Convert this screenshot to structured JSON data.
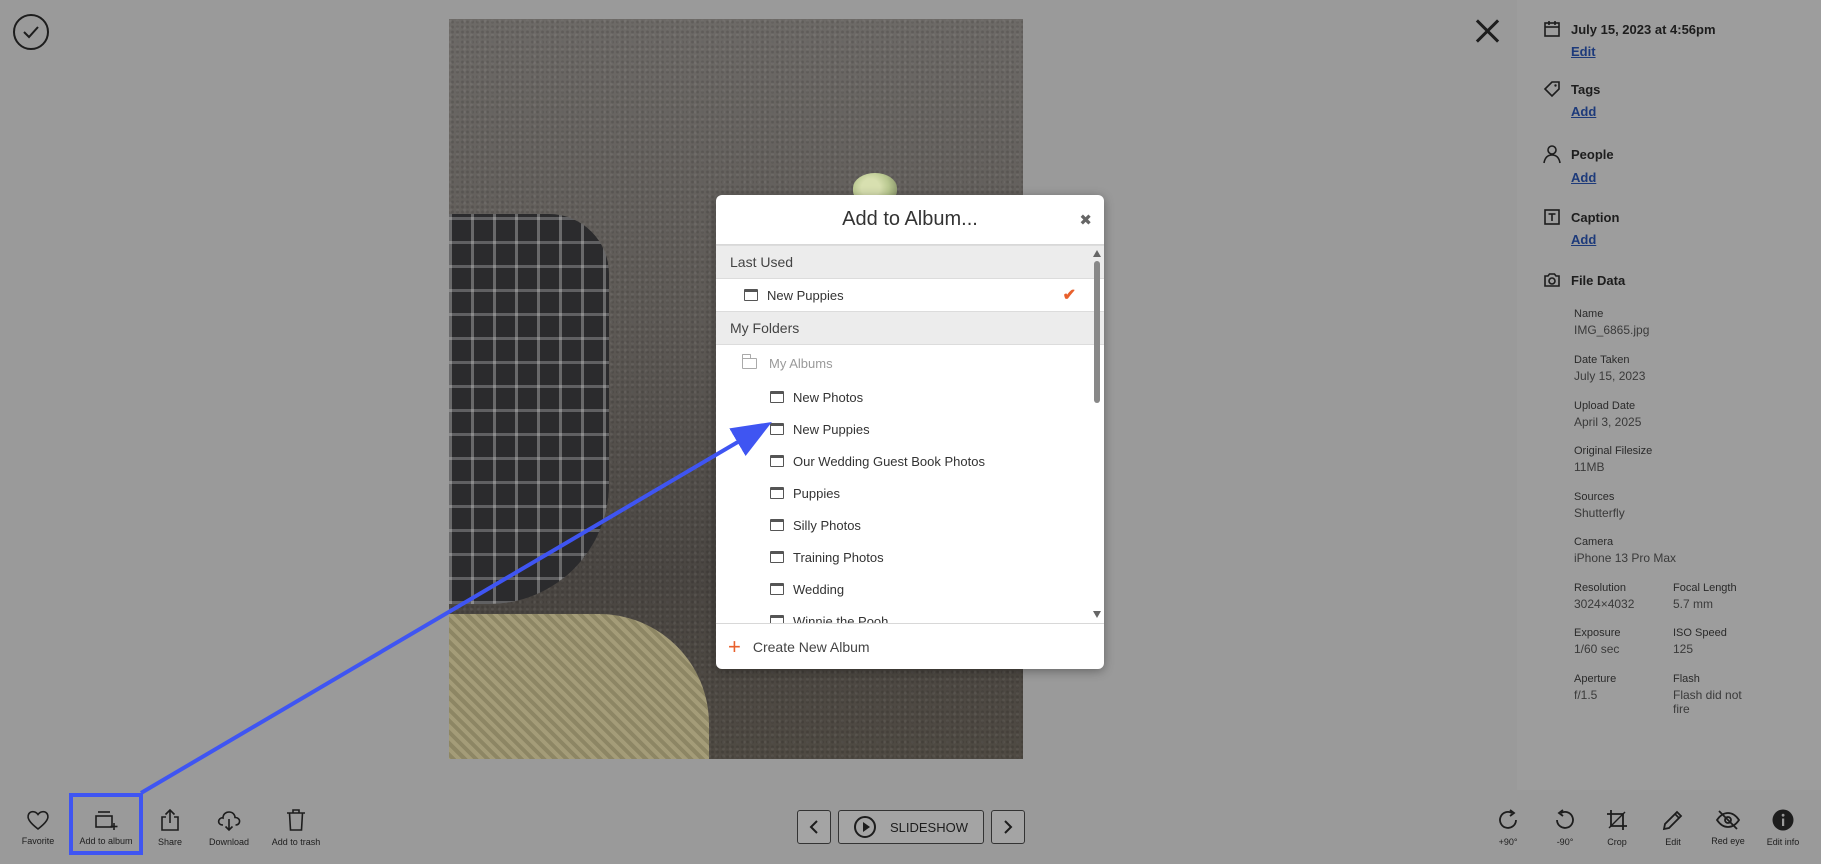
{
  "modal": {
    "title": "Add to Album...",
    "close": "✖",
    "last_used_header": "Last Used",
    "last_used_item": "New Puppies",
    "my_folders_header": "My Folders",
    "folder_name": "My Albums",
    "albums": [
      "New Photos",
      "New Puppies",
      "Our Wedding Guest Book Photos",
      "Puppies",
      "Silly Photos",
      "Training Photos",
      "Wedding",
      "Winnie the Pooh"
    ],
    "create_label": "Create New Album",
    "check": "✔",
    "plus": "+"
  },
  "toolbar": {
    "favorite": "Favorite",
    "add_to_album": "Add to album",
    "share": "Share",
    "download": "Download",
    "add_to_trash": "Add to trash",
    "slideshow": "SLIDESHOW",
    "rotate_cw": "+90°",
    "rotate_ccw": "-90°",
    "crop": "Crop",
    "edit": "Edit",
    "red_eye": "Red eye",
    "edit_info": "Edit info"
  },
  "info": {
    "date": "July 15, 2023 at 4:56pm",
    "date_edit": "Edit",
    "tags_title": "Tags",
    "tags_add": "Add",
    "people_title": "People",
    "people_add": "Add",
    "caption_title": "Caption",
    "caption_add": "Add",
    "file_data_title": "File Data",
    "file_data": {
      "name_label": "Name",
      "name": "IMG_6865.jpg",
      "date_taken_label": "Date Taken",
      "date_taken": "July 15, 2023",
      "upload_date_label": "Upload Date",
      "upload_date": "April 3, 2025",
      "filesize_label": "Original Filesize",
      "filesize": "11MB",
      "sources_label": "Sources",
      "sources": "Shutterfly",
      "camera_label": "Camera",
      "camera": "iPhone 13 Pro Max",
      "resolution_label": "Resolution",
      "resolution": "3024×4032",
      "focal_label": "Focal Length",
      "focal": "5.7 mm",
      "exposure_label": "Exposure",
      "exposure": "1/60 sec",
      "iso_label": "ISO Speed",
      "iso": "125",
      "aperture_label": "Aperture",
      "aperture": "f/1.5",
      "flash_label": "Flash",
      "flash": "Flash did not fire"
    }
  },
  "colors": {
    "accent": "#e8602c",
    "highlight": "#3f55f2",
    "link": "#1d3a7a"
  }
}
